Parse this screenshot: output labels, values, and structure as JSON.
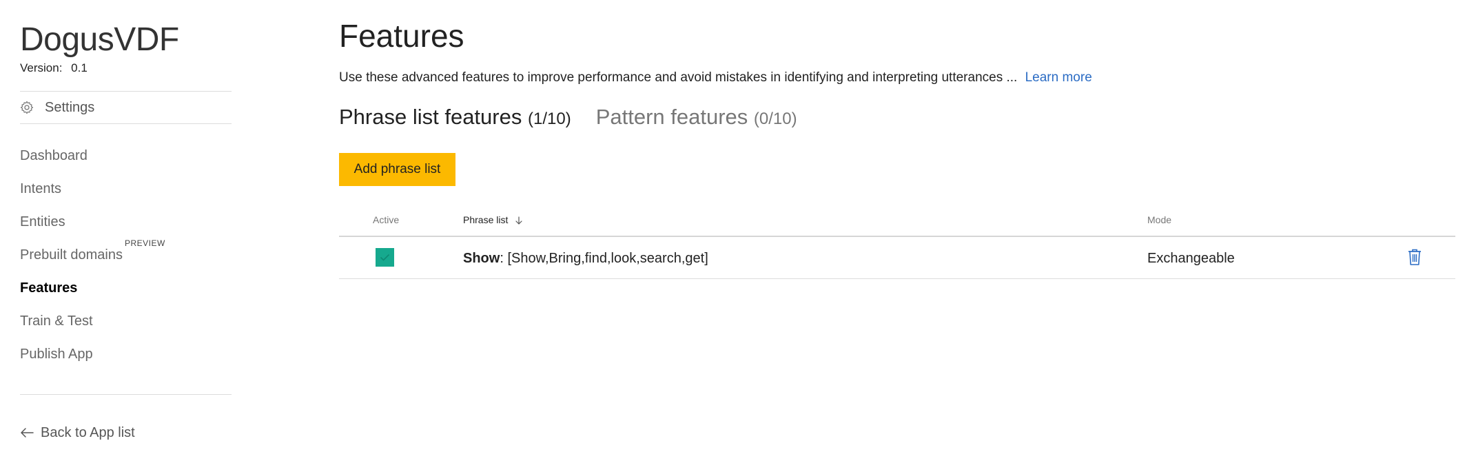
{
  "sidebar": {
    "app_name": "DogusVDF",
    "version_label": "Version:",
    "version_value": "0.1",
    "settings_label": "Settings",
    "settings_icon": "gear-icon",
    "items": [
      {
        "label": "Dashboard",
        "active": false
      },
      {
        "label": "Intents",
        "active": false
      },
      {
        "label": "Entities",
        "active": false
      },
      {
        "label": "Prebuilt domains",
        "active": false,
        "badge": "PREVIEW"
      },
      {
        "label": "Features",
        "active": true
      },
      {
        "label": "Train & Test",
        "active": false
      },
      {
        "label": "Publish App",
        "active": false
      }
    ],
    "back_label": "Back to App list",
    "back_icon": "arrow-left-icon"
  },
  "main": {
    "title": "Features",
    "description": "Use these advanced features to improve performance and avoid mistakes in identifying and interpreting utterances ...",
    "learn_more": "Learn more",
    "tabs": [
      {
        "label": "Phrase list features",
        "count": "(1/10)",
        "active": true
      },
      {
        "label": "Pattern features",
        "count": "(0/10)",
        "active": false
      }
    ],
    "add_button": "Add phrase list",
    "table": {
      "columns": {
        "active": "Active",
        "phrase_list": "Phrase list",
        "mode": "Mode"
      },
      "rows": [
        {
          "active": true,
          "name": "Show",
          "separator": ":",
          "values": "[Show,Bring,find,look,search,get]",
          "mode": "Exchangeable"
        }
      ]
    }
  },
  "colors": {
    "accent_button": "#fcb900",
    "checkbox": "#16a98e",
    "link": "#2b6cc4",
    "trash_icon": "#2b6cc4"
  }
}
